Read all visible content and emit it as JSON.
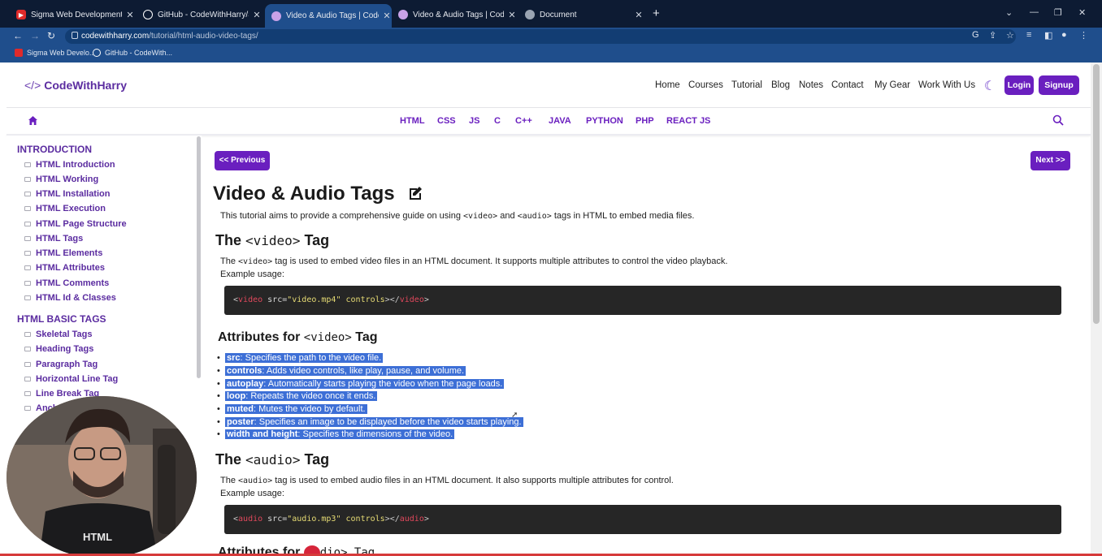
{
  "browser": {
    "tabs": [
      {
        "title": "Sigma Web Development Cours",
        "favicon": "youtube-icon",
        "favcolor": "#e02a2a"
      },
      {
        "title": "GitHub - CodeWithHarry/Sigma",
        "favicon": "github-icon",
        "favcolor": "#ffffff"
      },
      {
        "title": "Video & Audio Tags | CodeWith",
        "favicon": "codewithharry-icon",
        "favcolor": "#c9a2e8"
      },
      {
        "title": "Video & Audio Tags | CodeWith",
        "favicon": "codewithharry-icon",
        "favcolor": "#c9a2e8"
      },
      {
        "title": "Document",
        "favicon": "globe-icon",
        "favcolor": "#9aa4b2"
      }
    ],
    "url_host": "codewithharry.com",
    "url_path": "/tutorial/html-audio-video-tags/",
    "bookmarks": [
      {
        "label": "Sigma Web Develo...",
        "icon": "youtube-icon",
        "color": "#e02a2a"
      },
      {
        "label": "GitHub - CodeWith...",
        "icon": "github-icon",
        "color": "#ffffff"
      }
    ]
  },
  "header": {
    "logo_bracket": "</>",
    "logo_text": "CodeWithHarry",
    "nav": [
      "Home",
      "Courses",
      "Tutorial",
      "Blog",
      "Notes",
      "Contact",
      "My Gear",
      "Work With Us"
    ],
    "login": "Login",
    "signup": "Signup",
    "languages": [
      "HTML",
      "CSS",
      "JS",
      "C",
      "C++",
      "JAVA",
      "PYTHON",
      "PHP",
      "REACT JS"
    ]
  },
  "sidebar": {
    "section1": "INTRODUCTION",
    "items1": [
      "HTML Introduction",
      "HTML Working",
      "HTML Installation",
      "HTML Execution",
      "HTML Page Structure",
      "HTML Tags",
      "HTML Elements",
      "HTML Attributes",
      "HTML Comments",
      "HTML Id & Classes"
    ],
    "section2": "HTML BASIC TAGS",
    "items2": [
      "Skeletal Tags",
      "Heading Tags",
      "Paragraph Tag",
      "Horizontal Line Tag",
      "Line Break Tag",
      "Anch"
    ]
  },
  "main": {
    "prev": "<< Previous",
    "next": "Next >>",
    "title": "Video & Audio Tags",
    "intro_a": "This tutorial aims to provide a comprehensive guide on using ",
    "intro_code1": "<video>",
    "intro_b": " and ",
    "intro_code2": "<audio>",
    "intro_c": " tags in HTML to embed media files.",
    "video_h_a": "The ",
    "video_h_code": "<video>",
    "video_h_b": " Tag",
    "video_p_a": "The ",
    "video_p_code": "<video>",
    "video_p_b": " tag is used to embed video files in an HTML document. It supports multiple attributes to control the video playback.",
    "example_usage": "Example usage:",
    "video_code": {
      "open": "<",
      "tag": "video",
      "attr1": " src=",
      "val": "\"video.mp4\"",
      "attr2": " controls",
      "close": "></",
      "tag2": "video",
      "end": ">"
    },
    "attrs_h_a": "Attributes for ",
    "attrs_h_code": "<video>",
    "attrs_h_b": " Tag",
    "attrs": [
      {
        "name": "src",
        "desc": ": Specifies the path to the video file."
      },
      {
        "name": "controls",
        "desc": ": Adds video controls, like play, pause, and volume."
      },
      {
        "name": "autoplay",
        "desc": ": Automatically starts playing the video when the page loads."
      },
      {
        "name": "loop",
        "desc": ": Repeats the video once it ends."
      },
      {
        "name": "muted",
        "desc": ": Mutes the video by default."
      },
      {
        "name": "poster",
        "desc": ": Specifies an image to be displayed before the video starts playing."
      },
      {
        "name": "width and height",
        "desc": ": Specifies the dimensions of the video."
      }
    ],
    "audio_h_a": "The ",
    "audio_h_code": "<audio>",
    "audio_h_b": " Tag",
    "audio_p_a": "The ",
    "audio_p_code": "<audio>",
    "audio_p_b": " tag is used to embed audio files in an HTML document. It also supports multiple attributes for control.",
    "example_usage2": "Example usage:",
    "audio_code": {
      "open": "<",
      "tag": "audio",
      "attr1": " src=",
      "val": "\"audio.mp3\"",
      "attr2": " controls",
      "close": "></",
      "tag2": "audio",
      "end": ">"
    },
    "next_h_partial": "Attributes for ",
    "next_h_tail": "dio> Tag"
  },
  "colors": {
    "brand": "#6a1fbf",
    "highlight": "#3d6fd6",
    "chrome": "#1f4e8c"
  }
}
